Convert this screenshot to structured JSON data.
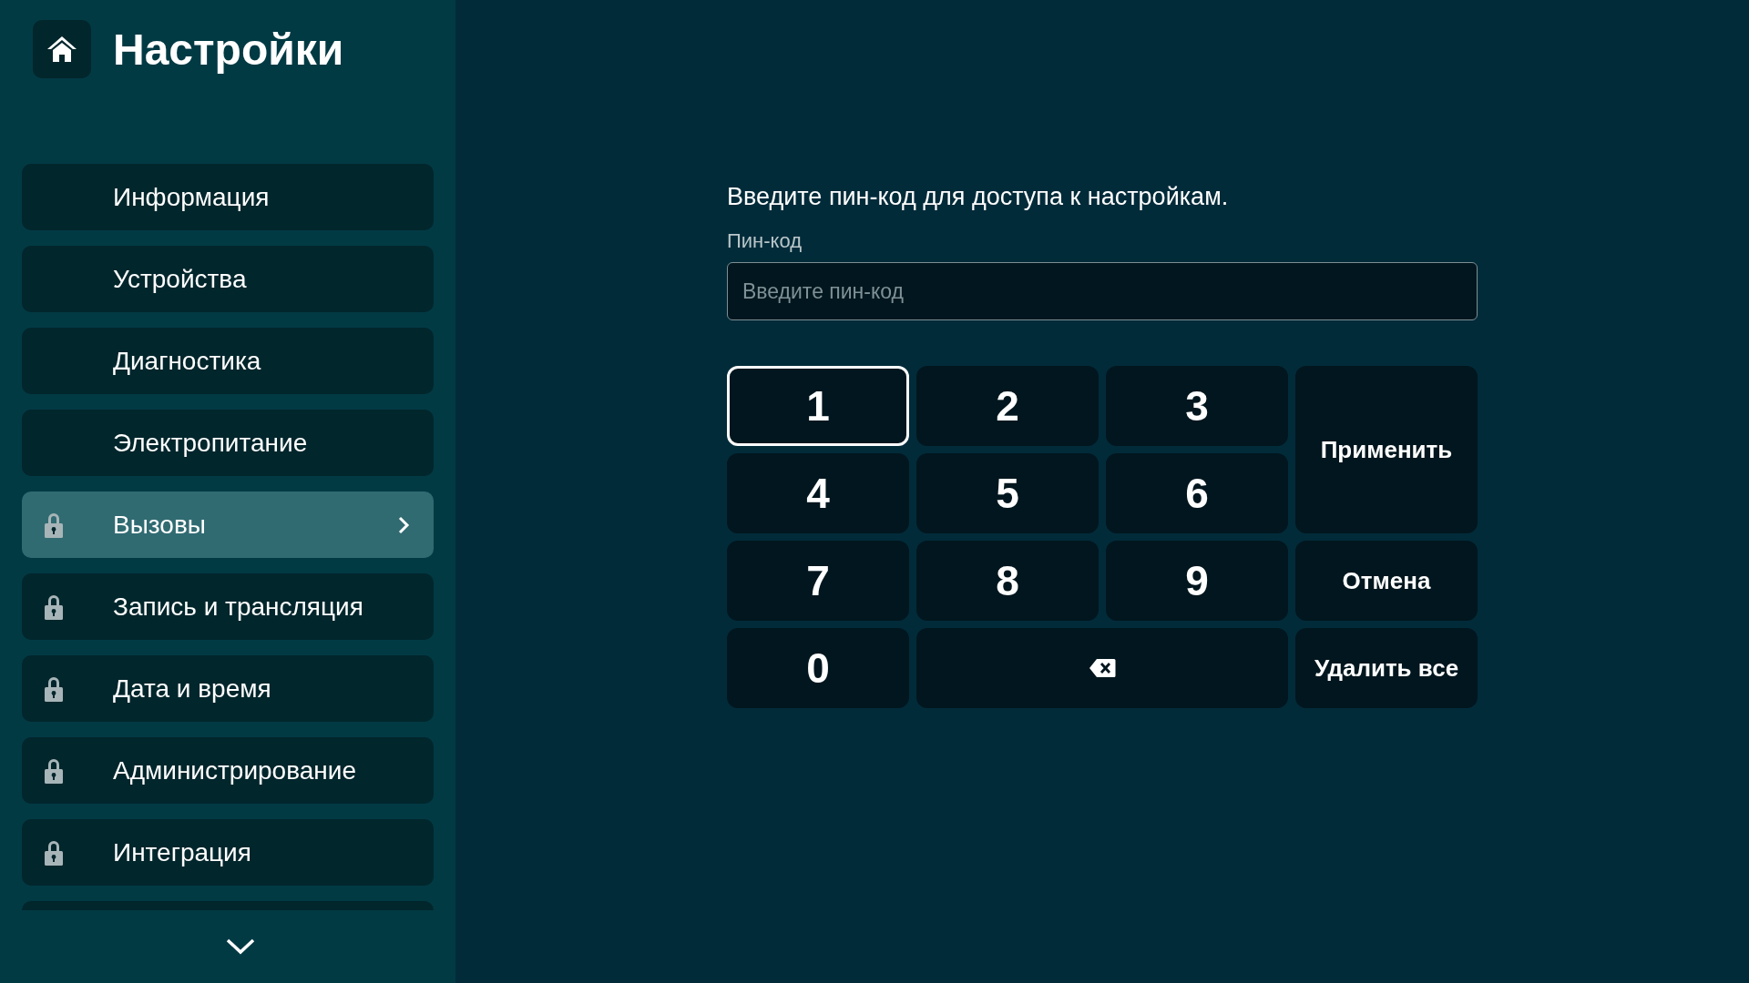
{
  "header": {
    "title": "Настройки"
  },
  "menu": [
    {
      "label": "Информация",
      "locked": false,
      "selected": false
    },
    {
      "label": "Устройства",
      "locked": false,
      "selected": false
    },
    {
      "label": "Диагностика",
      "locked": false,
      "selected": false
    },
    {
      "label": "Электропитание",
      "locked": false,
      "selected": false
    },
    {
      "label": "Вызовы",
      "locked": true,
      "selected": true
    },
    {
      "label": "Запись и трансляция",
      "locked": true,
      "selected": false
    },
    {
      "label": "Дата и время",
      "locked": true,
      "selected": false
    },
    {
      "label": "Администрирование",
      "locked": true,
      "selected": false
    },
    {
      "label": "Интеграция",
      "locked": true,
      "selected": false
    }
  ],
  "prompt": "Введите пин-код для доступа к настройкам.",
  "pin_field": {
    "label": "Пин-код",
    "placeholder": "Введите пин-код"
  },
  "keypad": [
    {
      "kind": "digit",
      "label": "1",
      "focused": true
    },
    {
      "kind": "digit",
      "label": "2",
      "focused": false
    },
    {
      "kind": "digit",
      "label": "3",
      "focused": false
    },
    {
      "kind": "apply",
      "label": "Применить",
      "focused": false
    },
    {
      "kind": "digit",
      "label": "4",
      "focused": false
    },
    {
      "kind": "digit",
      "label": "5",
      "focused": false
    },
    {
      "kind": "digit",
      "label": "6",
      "focused": false
    },
    {
      "kind": "digit",
      "label": "7",
      "focused": false
    },
    {
      "kind": "digit",
      "label": "8",
      "focused": false
    },
    {
      "kind": "digit",
      "label": "9",
      "focused": false
    },
    {
      "kind": "cancel",
      "label": "Отмена",
      "focused": false
    },
    {
      "kind": "digit",
      "label": "0",
      "focused": false
    },
    {
      "kind": "backspace",
      "focused": false
    },
    {
      "kind": "clear",
      "label": "Удалить все",
      "focused": false
    }
  ]
}
